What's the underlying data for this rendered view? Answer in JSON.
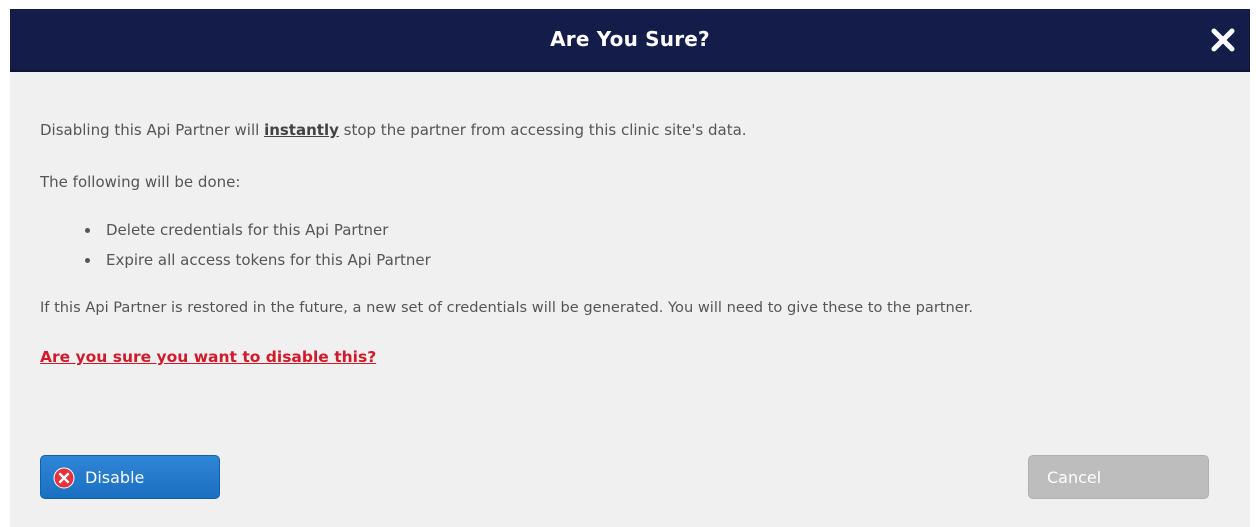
{
  "dialog": {
    "title": "Are You Sure?",
    "close_icon": "close-icon",
    "colors": {
      "titlebar": "#141d4a",
      "body_background": "#f0f0f0",
      "warning_text": "#d11a2a",
      "primary_button": "#1f76c9",
      "disabled_button": "#bdbdbd"
    }
  },
  "message": {
    "intro_before": "Disabling this Api Partner will ",
    "intro_emphasis": "instantly",
    "intro_after": " stop the partner from accessing this clinic site's data.",
    "followup": "The following will be done:",
    "bullets": [
      "Delete credentials for this Api Partner",
      "Expire all access tokens for this Api Partner"
    ],
    "restore_note": "If this Api Partner is restored in the future, a new set of credentials will be generated. You will need to give these to the partner.",
    "confirm_question": "Are you sure you want to disable this?"
  },
  "buttons": {
    "disable": {
      "label": "Disable",
      "icon": "disable-icon"
    },
    "cancel": {
      "label": "Cancel",
      "state": "disabled"
    }
  }
}
